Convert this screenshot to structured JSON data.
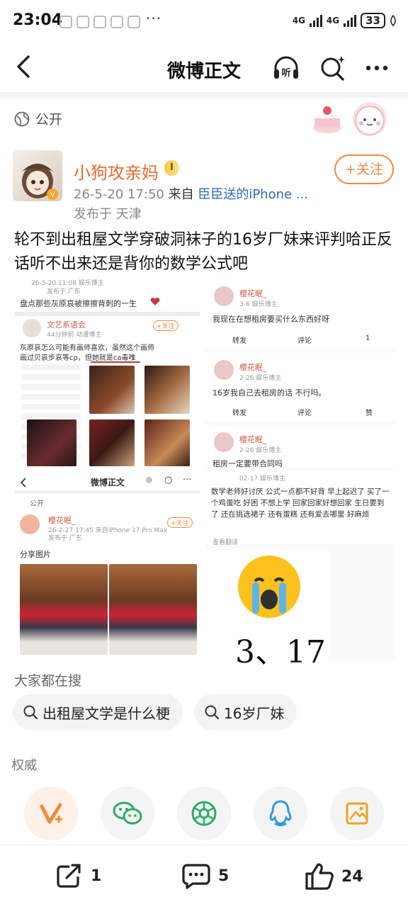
{
  "status_bar": {
    "time": "23:04",
    "dots": "···",
    "net1": "4G",
    "net2": "4G",
    "battery": "33"
  },
  "header": {
    "title": "微博正文"
  },
  "post": {
    "visibility": "公开",
    "username": "小狗攻亲妈",
    "badge": "I",
    "time": "26-5-20 17:50",
    "from_label": "来自",
    "source": "臣臣送的iPhone ...",
    "location": "发布于 天津",
    "follow_label": "+关注",
    "text": "轮不到出租屋文学穿破洞袜子的16岁厂妹来评判哈正反话听不出来还是背你的数学公式吧"
  },
  "collage": {
    "left_top": {
      "meta": "26-5-20 11:08  娱乐博主",
      "meta2": "发布于 广东",
      "line": "盘点那些灰原哀被擦擦背刺的一生",
      "quoted_name": "文艺系语会",
      "quoted_meta": "44分钟前  动漫博主",
      "follow": "+关注",
      "quote1": "灰原哀怎么可能有画师喜欢，虽然这个画师",
      "quote2": "画过贝哀步哀等cp，但她就是ca毒唯"
    },
    "left_bottom": {
      "title": "微博正文",
      "visibility": "公开",
      "name": "樱花眠_",
      "meta": "26-2-27 17:45  来自iPhone 17 Pro Max",
      "meta2": "发布于 广东",
      "follow": "+关注",
      "caption": "分享图片"
    },
    "right": {
      "c1_name": "樱花眠_",
      "c1_meta": "3-6  娱乐博主",
      "c1_text": "我现在在想租房要买什么东西好呀",
      "c1_repost": "转发",
      "c1_comment": "评论",
      "c1_like": "1",
      "c2_name": "樱花眠_",
      "c2_meta": "2-26  娱乐博主",
      "c2_text": "16岁我自己去租房的话 不行吗。",
      "c2_repost": "转发",
      "c2_comment": "评论",
      "c2_like": "赞",
      "c3_name": "樱花眠_",
      "c3_meta": "2-26  娱乐博主",
      "c3_text": "租房一定要带合同吗",
      "c4_meta": "02-17  娱乐博主",
      "c4_text": "数学老师好讨厌 公式一点都不好背 早上起迟了 买了一个鸡蛋吃 好困 不想上学 回家回家好想回家 生日要到了 还在挑选裙子 还有蛋糕 还有爱去哪里 好麻烦",
      "c4_more": "查看翻译",
      "handwriting": "3、17"
    }
  },
  "search": {
    "title": "大家都在搜",
    "chips": [
      "出租屋文学是什么梗",
      "16岁厂妹"
    ]
  },
  "authority_label": "权威",
  "share_targets": [
    "weibo-v-icon",
    "wechat-icon",
    "moments-icon",
    "qq-icon",
    "save-image-icon"
  ],
  "bottom_bar": {
    "repost_count": "1",
    "comment_count": "5",
    "like_count": "24"
  },
  "colors": {
    "accent_orange": "#f08a3c",
    "username_orange": "#e86a2c",
    "link_blue": "#2f6db5"
  }
}
